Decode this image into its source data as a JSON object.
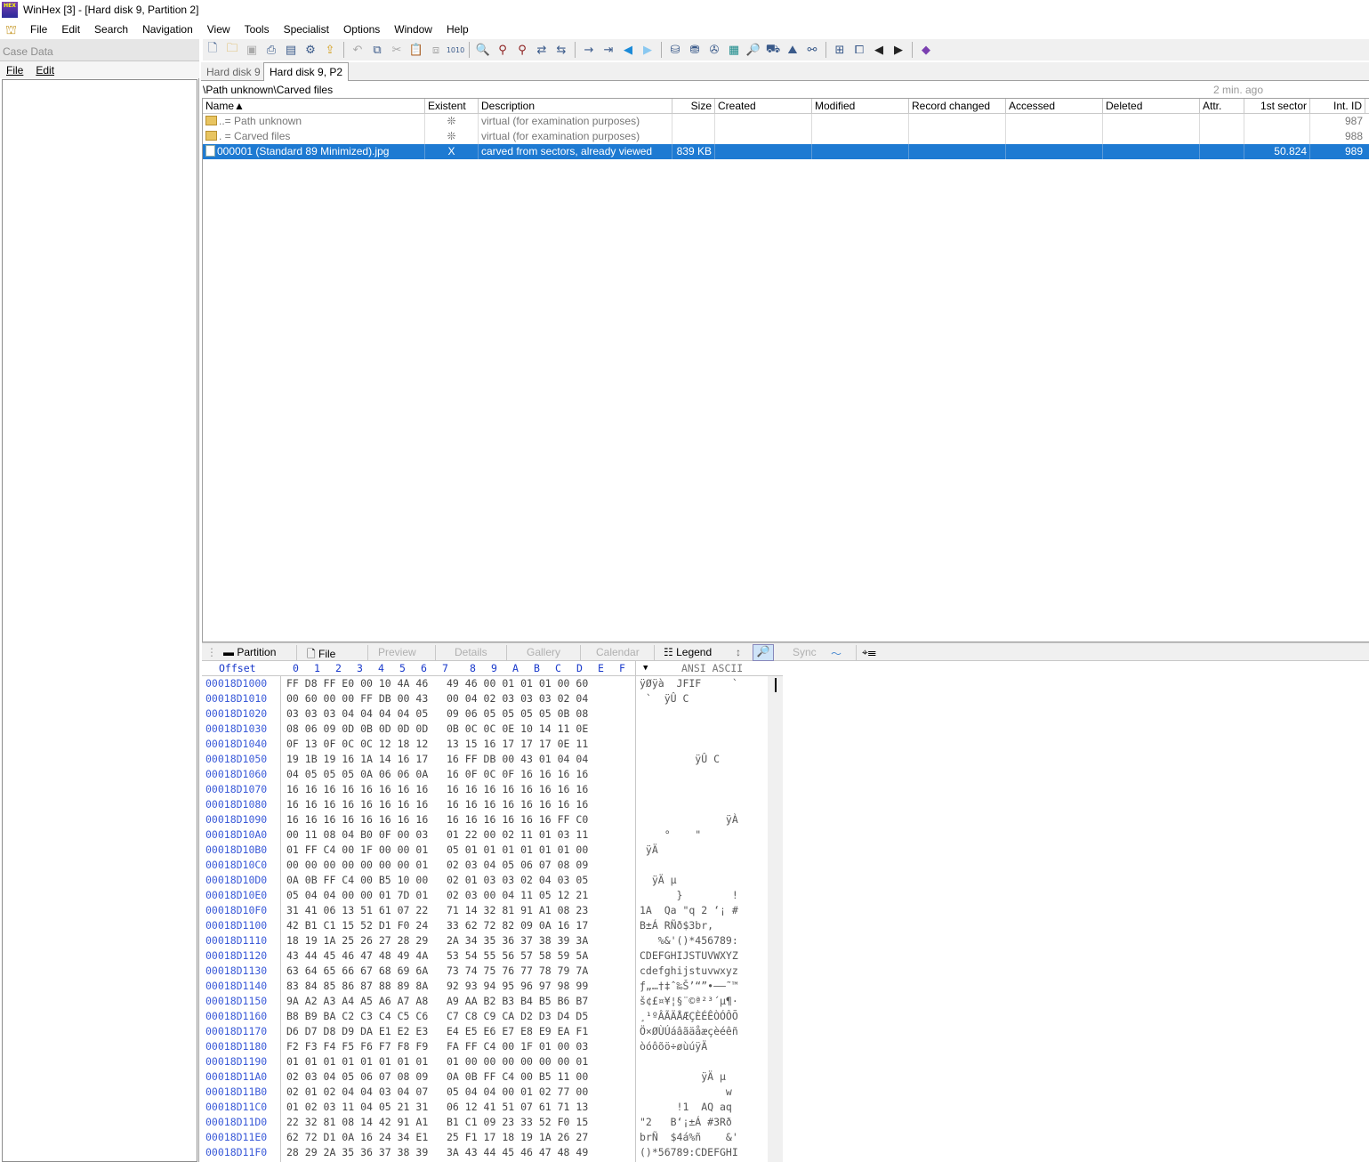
{
  "window": {
    "title": "WinHex [3] - [Hard disk 9, Partition 2]",
    "icon_text": "HEX"
  },
  "menu": [
    "File",
    "Edit",
    "Search",
    "Navigation",
    "View",
    "Tools",
    "Specialist",
    "Options",
    "Window",
    "Help"
  ],
  "case_data": {
    "title": "Case Data",
    "menu": [
      "File",
      "Edit"
    ]
  },
  "tabs": [
    "Hard disk 9",
    "Hard disk 9, P2"
  ],
  "path": {
    "text": "\\Path unknown\\Carved files",
    "updated": "2 min. ago"
  },
  "columns": [
    "Name",
    "Existent",
    "Description",
    "Size",
    "Created",
    "Modified",
    "Record changed",
    "Accessed",
    "Deleted",
    "Attr.",
    "1st sector",
    "Int. ID"
  ],
  "sort_indicator": "▲",
  "files": [
    {
      "name": "Path unknown",
      "prefix": "..=",
      "existent": "❊",
      "description": "virtual (for examination purposes)",
      "size": "",
      "first_sector": "",
      "int_id": "987",
      "selected": false
    },
    {
      "name": "Carved files",
      "prefix": ". =",
      "existent": "❊",
      "description": "virtual (for examination purposes)",
      "size": "",
      "first_sector": "",
      "int_id": "988",
      "selected": false
    },
    {
      "name": "000001 (Standard 89 Minimized).jpg",
      "prefix": "",
      "existent": "X",
      "description": "carved from sectors, already viewed",
      "size": "839 KB",
      "first_sector": "50.824",
      "int_id": "989",
      "selected": true
    }
  ],
  "lower_tabs": {
    "partition": "Partition",
    "file": "File",
    "preview": "Preview",
    "details": "Details",
    "gallery": "Gallery",
    "calendar": "Calendar",
    "legend": "Legend",
    "sync": "Sync"
  },
  "hex": {
    "offset_label": "Offset",
    "col_headers": [
      "0",
      "1",
      "2",
      "3",
      "4",
      "5",
      "6",
      "7",
      "8",
      "9",
      "A",
      "B",
      "C",
      "D",
      "E",
      "F"
    ],
    "ansi_label": "ANSI ASCII",
    "rows": [
      {
        "o": "00018D1000",
        "h": "FF D8 FF E0 00 10 4A 46   49 46 00 01 01 01 00 60",
        "a": "ÿØÿà  JFIF     `"
      },
      {
        "o": "00018D1010",
        "h": "00 60 00 00 FF DB 00 43   00 04 02 03 03 03 02 04",
        "a": " `  ÿÛ C        "
      },
      {
        "o": "00018D1020",
        "h": "03 03 03 04 04 04 04 05   09 06 05 05 05 05 0B 08",
        "a": ""
      },
      {
        "o": "00018D1030",
        "h": "08 06 09 0D 0B 0D 0D 0D   0B 0C 0C 0E 10 14 11 0E",
        "a": ""
      },
      {
        "o": "00018D1040",
        "h": "0F 13 0F 0C 0C 12 18 12   13 15 16 17 17 17 0E 11",
        "a": ""
      },
      {
        "o": "00018D1050",
        "h": "19 1B 19 16 1A 14 16 17   16 FF DB 00 43 01 04 04",
        "a": "         ÿÛ C   "
      },
      {
        "o": "00018D1060",
        "h": "04 05 05 05 0A 06 06 0A   16 0F 0C 0F 16 16 16 16",
        "a": ""
      },
      {
        "o": "00018D1070",
        "h": "16 16 16 16 16 16 16 16   16 16 16 16 16 16 16 16",
        "a": ""
      },
      {
        "o": "00018D1080",
        "h": "16 16 16 16 16 16 16 16   16 16 16 16 16 16 16 16",
        "a": ""
      },
      {
        "o": "00018D1090",
        "h": "16 16 16 16 16 16 16 16   16 16 16 16 16 16 FF C0",
        "a": "              ÿÀ"
      },
      {
        "o": "00018D10A0",
        "h": "00 11 08 04 B0 0F 00 03   01 22 00 02 11 01 03 11",
        "a": "    °    \"      "
      },
      {
        "o": "00018D10B0",
        "h": "01 FF C4 00 1F 00 00 01   05 01 01 01 01 01 01 00",
        "a": " ÿÄ             "
      },
      {
        "o": "00018D10C0",
        "h": "00 00 00 00 00 00 00 01   02 03 04 05 06 07 08 09",
        "a": ""
      },
      {
        "o": "00018D10D0",
        "h": "0A 0B FF C4 00 B5 10 00   02 01 03 03 02 04 03 05",
        "a": "  ÿÄ µ          "
      },
      {
        "o": "00018D10E0",
        "h": "05 04 04 00 00 01 7D 01   02 03 00 04 11 05 12 21",
        "a": "      }        !"
      },
      {
        "o": "00018D10F0",
        "h": "31 41 06 13 51 61 07 22   71 14 32 81 91 A1 08 23",
        "a": "1A  Qa \"q 2 ‘¡ #"
      },
      {
        "o": "00018D1100",
        "h": "42 B1 C1 15 52 D1 F0 24   33 62 72 82 09 0A 16 17",
        "a": "B±Á RÑð$3br,    "
      },
      {
        "o": "00018D1110",
        "h": "18 19 1A 25 26 27 28 29   2A 34 35 36 37 38 39 3A",
        "a": "   %&'()*456789:"
      },
      {
        "o": "00018D1120",
        "h": "43 44 45 46 47 48 49 4A   53 54 55 56 57 58 59 5A",
        "a": "CDEFGHIJSTUVWXYZ"
      },
      {
        "o": "00018D1130",
        "h": "63 64 65 66 67 68 69 6A   73 74 75 76 77 78 79 7A",
        "a": "cdefghijstuvwxyz"
      },
      {
        "o": "00018D1140",
        "h": "83 84 85 86 87 88 89 8A   92 93 94 95 96 97 98 99",
        "a": "ƒ„…†‡ˆ‰Š’“”•–—˜™"
      },
      {
        "o": "00018D1150",
        "h": "9A A2 A3 A4 A5 A6 A7 A8   A9 AA B2 B3 B4 B5 B6 B7",
        "a": "š¢£¤¥¦§¨©ª²³´µ¶·"
      },
      {
        "o": "00018D1160",
        "h": "B8 B9 BA C2 C3 C4 C5 C6   C7 C8 C9 CA D2 D3 D4 D5",
        "a": "¸¹ºÂÃÄÅÆÇÈÉÊÒÓÔÕ"
      },
      {
        "o": "00018D1170",
        "h": "D6 D7 D8 D9 DA E1 E2 E3   E4 E5 E6 E7 E8 E9 EA F1",
        "a": "Ö×ØÙÚáâãäåæçèéêñ"
      },
      {
        "o": "00018D1180",
        "h": "F2 F3 F4 F5 F6 F7 F8 F9   FA FF C4 00 1F 01 00 03",
        "a": "òóôõö÷øùúÿÄ     "
      },
      {
        "o": "00018D1190",
        "h": "01 01 01 01 01 01 01 01   01 00 00 00 00 00 00 01",
        "a": ""
      },
      {
        "o": "00018D11A0",
        "h": "02 03 04 05 06 07 08 09   0A 0B FF C4 00 B5 11 00",
        "a": "          ÿÄ µ  "
      },
      {
        "o": "00018D11B0",
        "h": "02 01 02 04 04 03 04 07   05 04 04 00 01 02 77 00",
        "a": "              w "
      },
      {
        "o": "00018D11C0",
        "h": "01 02 03 11 04 05 21 31   06 12 41 51 07 61 71 13",
        "a": "      !1  AQ aq "
      },
      {
        "o": "00018D11D0",
        "h": "22 32 81 08 14 42 91 A1   B1 C1 09 23 33 52 F0 15",
        "a": "\"2   B‘¡±Á #3Rð "
      },
      {
        "o": "00018D11E0",
        "h": "62 72 D1 0A 16 24 34 E1   25 F1 17 18 19 1A 26 27",
        "a": "brÑ  $4á%ñ    &'"
      },
      {
        "o": "00018D11F0",
        "h": "28 29 2A 35 36 37 38 39   3A 43 44 45 46 47 48 49",
        "a": "()*56789:CDEFGHI"
      }
    ]
  }
}
